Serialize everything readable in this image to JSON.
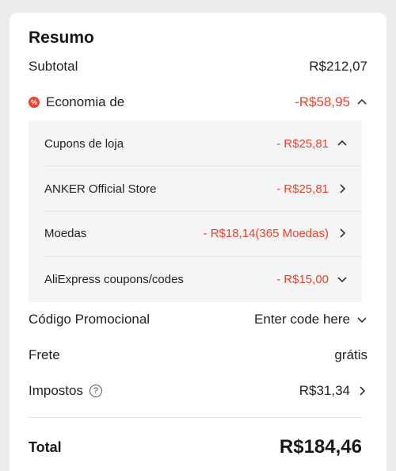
{
  "summary": {
    "title": "Resumo",
    "subtotal_label": "Subtotal",
    "subtotal_value": "R$212,07",
    "savings_label": "Economia de",
    "savings_value": "-R$58,95",
    "savings_badge": "%",
    "savings_breakdown": [
      {
        "label": "Cupons de loja",
        "value": "- R$25,81",
        "chevron": "up"
      },
      {
        "label": "ANKER Official Store",
        "value": "- R$25,81",
        "chevron": "right"
      },
      {
        "label": "Moedas",
        "value": "- R$18,14(365 Moedas)",
        "chevron": "right"
      },
      {
        "label": "AliExpress coupons/codes",
        "value": "- R$15,00",
        "chevron": "down"
      }
    ],
    "promo_label": "Código Promocional",
    "promo_placeholder": "Enter code here",
    "shipping_label": "Frete",
    "shipping_value": "grátis",
    "taxes_label": "Impostos",
    "taxes_help": "?",
    "taxes_value": "R$31,34",
    "total_label": "Total",
    "total_value": "R$184,46"
  },
  "colors": {
    "accent_red": "#ef3f2a",
    "panel_bg": "#f5f5f5",
    "page_bg": "#ebebeb"
  }
}
